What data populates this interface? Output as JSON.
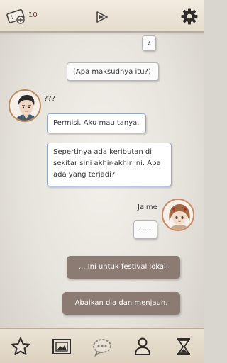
{
  "header": {
    "ticket_count": "10"
  },
  "messages": [
    {
      "sender": "player",
      "text": "?"
    },
    {
      "sender": "player",
      "text": "(Apa maksudnya itu?)"
    },
    {
      "sender": "npc",
      "speaker": "???",
      "text": "Permisi. Aku mau tanya."
    },
    {
      "sender": "npc",
      "speaker": "???",
      "text": "Sepertinya ada keributan di sekitar sini akhir-akhir ini. Apa ada yang terjadi?"
    },
    {
      "sender": "player",
      "speaker": "Jaime",
      "text": "....."
    }
  ],
  "choices": [
    "... Ini untuk festival lokal.",
    "Abaikan dia dan menjauh."
  ],
  "nav": {
    "items": [
      "star-icon",
      "album-icon",
      "chat-icon",
      "profile-icon",
      "hourglass-icon"
    ]
  },
  "colors": {
    "npc_bubble_border": "#8fa8c6",
    "choice_bg": "#8c7b72",
    "ticket_count": "#8a2b24"
  }
}
